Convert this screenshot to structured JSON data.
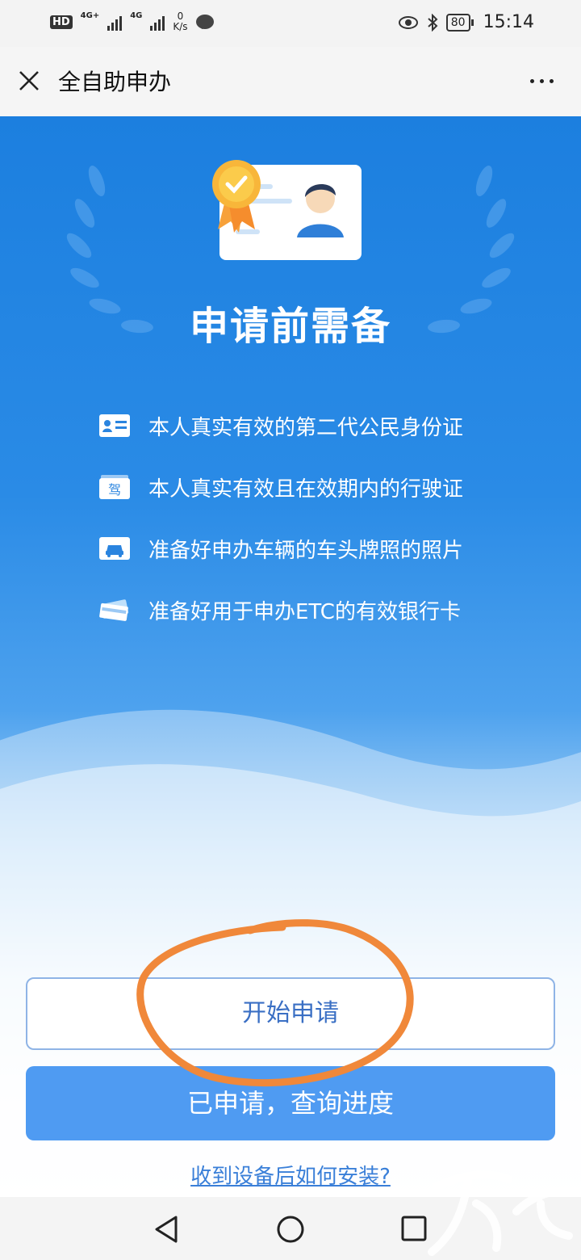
{
  "status_bar": {
    "network_1": "4G+",
    "network_2": "4G",
    "speed_value": "0",
    "speed_unit": "K/s",
    "battery": "80",
    "time": "15:14"
  },
  "header": {
    "title": "全自助申办",
    "close_icon": "close-icon",
    "more_icon": "more-icon"
  },
  "hero": {
    "title": "申请前需备",
    "requirements": [
      {
        "icon": "id-card-icon",
        "text": "本人真实有效的第二代公民身份证"
      },
      {
        "icon": "driving-license-icon",
        "text": "本人真实有效且在效期内的行驶证",
        "icon_label": "驾"
      },
      {
        "icon": "car-photo-icon",
        "text": "准备好申办车辆的车头牌照的照片"
      },
      {
        "icon": "bank-card-icon",
        "text": "准备好用于申办ETC的有效银行卡"
      }
    ]
  },
  "actions": {
    "start_label": "开始申请",
    "query_label": "已申请，查询进度",
    "install_link": "收到设备后如何安装?"
  },
  "colors": {
    "hero_blue": "#1c7fdf",
    "primary_button": "#4f9bf2",
    "annotation_orange": "#f0883a"
  },
  "nav": {
    "back_icon": "triangle-back-icon",
    "home_icon": "circle-home-icon",
    "recent_icon": "square-recent-icon"
  }
}
